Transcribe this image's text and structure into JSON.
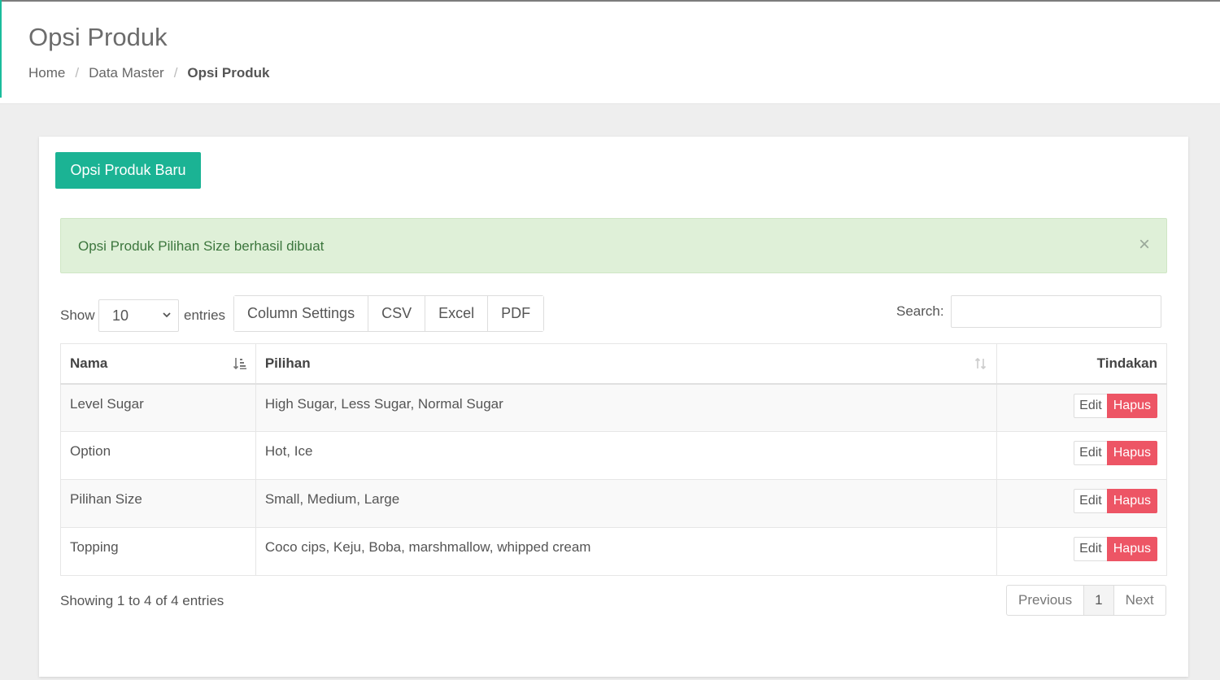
{
  "header": {
    "title": "Opsi Produk",
    "breadcrumb": [
      {
        "label": "Home"
      },
      {
        "label": "Data Master"
      },
      {
        "label": "Opsi Produk"
      }
    ],
    "separator": "/"
  },
  "toolbar": {
    "new_button": "Opsi Produk Baru"
  },
  "alert": {
    "message": "Opsi Produk Pilihan Size berhasil dibuat",
    "close": "×"
  },
  "controls": {
    "show_label": "Show",
    "length_value": "10",
    "entries_label": "entries",
    "buttons": [
      "Column Settings",
      "CSV",
      "Excel",
      "PDF"
    ],
    "search_label": "Search:",
    "search_value": ""
  },
  "table": {
    "columns": [
      "Nama",
      "Pilihan",
      "Tindakan"
    ],
    "rows": [
      {
        "nama": "Level Sugar",
        "pilihan": "High Sugar, Less Sugar, Normal Sugar"
      },
      {
        "nama": "Option",
        "pilihan": "Hot, Ice"
      },
      {
        "nama": "Pilihan Size",
        "pilihan": "Small, Medium, Large"
      },
      {
        "nama": "Topping",
        "pilihan": "Coco cips, Keju, Boba, marshmallow, whipped cream"
      }
    ],
    "edit_label": "Edit",
    "delete_label": "Hapus"
  },
  "footer": {
    "info": "Showing 1 to 4 of 4 entries",
    "previous": "Previous",
    "page": "1",
    "next": "Next"
  },
  "colors": {
    "primary": "#1bb394",
    "danger": "#ed5565",
    "success_bg": "#dff0d8",
    "success_text": "#3c763d"
  },
  "icons": {
    "sort_active": "sort-amount-asc-icon",
    "sort_inactive": "sort-icon",
    "close": "close-icon",
    "chevron": "chevron-down-icon"
  }
}
